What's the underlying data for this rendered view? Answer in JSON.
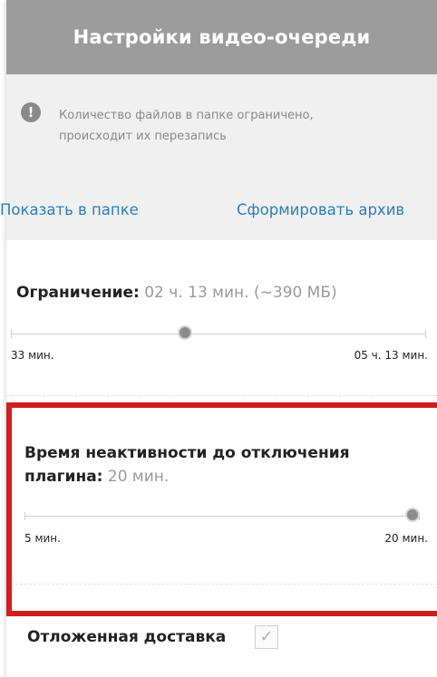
{
  "panel": {
    "title": "Настройки видео-очереди"
  },
  "info": {
    "icon": "exclamation-icon",
    "glyph": "!",
    "line1": "Количество файлов в папке ограничено,",
    "line2": "происходит их перезапись"
  },
  "links": {
    "show_in_folder": "Показать в папке",
    "create_archive": "Сформировать архив"
  },
  "limit": {
    "label": "Ограничение:",
    "value": "02 ч. 13 мин. (~390 МБ)",
    "min_label": "33 мин.",
    "max_label": "05 ч. 13 мин.",
    "position": 0.42
  },
  "inactivity": {
    "label_line1": "Время неактивности до отключения",
    "label_line2": "плагина:",
    "value": "20 мин.",
    "min_label": "5 мин.",
    "max_label": "20 мин.",
    "position": 1.0
  },
  "delayed": {
    "label": "Отложенная доставка",
    "checked": true,
    "check_glyph": "✓"
  },
  "colors": {
    "header_bg": "#9c9c9c",
    "link": "#2a7fbf",
    "highlight": "#d21e1e"
  }
}
